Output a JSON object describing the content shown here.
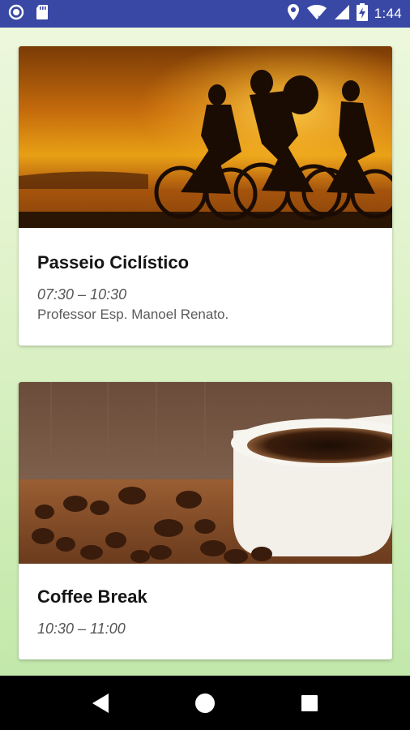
{
  "status_bar": {
    "time": "1:44",
    "icons": [
      "notification-circle-icon",
      "sd-card-icon",
      "location-icon",
      "wifi-icon",
      "signal-icon",
      "battery-charging-icon"
    ],
    "background_color": "#3948a5"
  },
  "cards": [
    {
      "image": "cycling-sunset-photo",
      "title": "Passeio Ciclístico",
      "time": "07:30 – 10:30",
      "description": "Professor Esp. Manoel Renato."
    },
    {
      "image": "coffee-cup-beans-photo",
      "title": "Coffee Break",
      "time": "10:30 – 11:00"
    }
  ],
  "nav_bar": {
    "buttons": [
      "back-icon",
      "home-icon",
      "recents-icon"
    ]
  }
}
